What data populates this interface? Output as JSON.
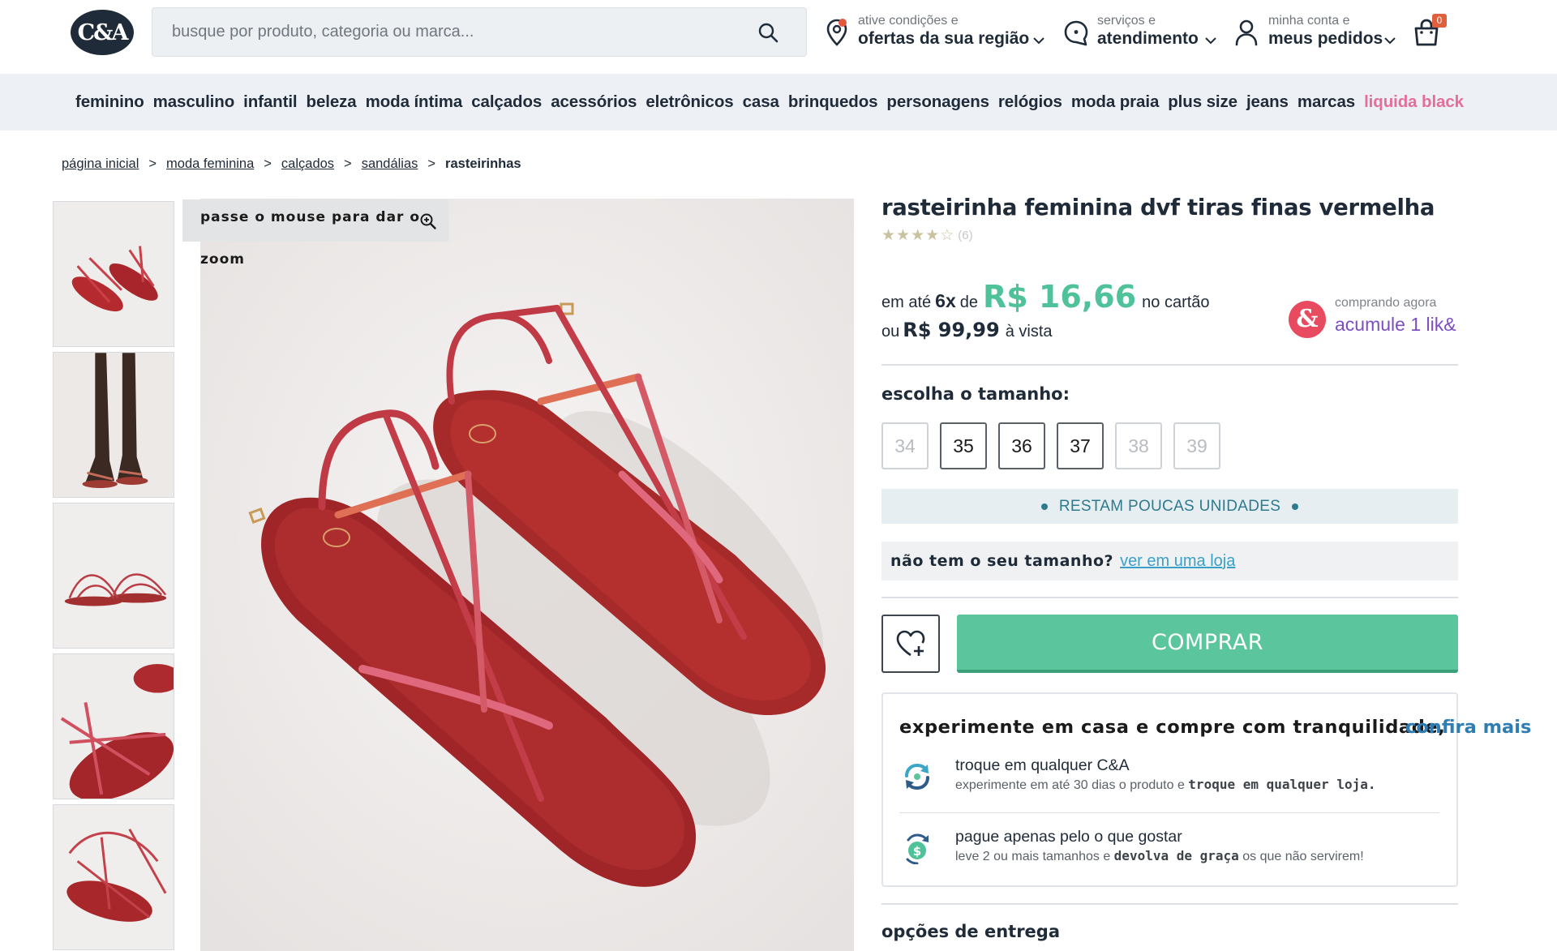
{
  "header": {
    "logo_text": "C&A",
    "search_placeholder": "busque por produto, categoria ou marca...",
    "location": {
      "small": "ative condições e",
      "big": "ofertas da sua região"
    },
    "service": {
      "small": "serviços e",
      "big": "atendimento"
    },
    "account": {
      "small": "minha conta e",
      "big": "meus pedidos"
    },
    "cart_count": "0"
  },
  "nav": {
    "items": [
      "feminino",
      "masculino",
      "infantil",
      "beleza",
      "moda íntima",
      "calçados",
      "acessórios",
      "eletrônicos",
      "casa",
      "brinquedos",
      "personagens",
      "relógios",
      "moda praia",
      "plus size",
      "jeans",
      "marcas"
    ],
    "promo": "liquida black"
  },
  "breadcrumb": {
    "items": [
      "página inicial",
      "moda feminina",
      "calçados",
      "sandálias"
    ],
    "separator": ">",
    "current": "rasteirinhas"
  },
  "gallery": {
    "zoom_hint_line1": "passe o mouse para dar o",
    "zoom_hint_line2": "zoom"
  },
  "product": {
    "title": "rasteirinha feminina dvf tiras finas vermelha",
    "rating": 4,
    "rating_max": 5,
    "review_count": "(6)",
    "installment_prefix": "em até",
    "installment_count": "6x",
    "installment_of": "de",
    "installment_value": "R$ 16,66",
    "installment_suffix": "no cartão",
    "cash_prefix": "ou",
    "cash_value": "R$ 99,99",
    "cash_suffix": "à vista"
  },
  "likand": {
    "icon": "&",
    "small": "comprando agora",
    "big": "acumule 1 lik&"
  },
  "sizes": {
    "title": "escolha o tamanho:",
    "options": [
      {
        "label": "34",
        "available": false
      },
      {
        "label": "35",
        "available": true
      },
      {
        "label": "36",
        "available": true
      },
      {
        "label": "37",
        "available": true
      },
      {
        "label": "38",
        "available": false
      },
      {
        "label": "39",
        "available": false
      }
    ]
  },
  "stock": {
    "text": "RESTAM POUCAS UNIDADES"
  },
  "no_size": {
    "label": "não tem o seu tamanho?",
    "link": "ver em uma loja"
  },
  "actions": {
    "buy_label": "COMPRAR"
  },
  "trial": {
    "title": "experimente em casa e compre com tranquilidade,",
    "link": "confira mais",
    "item1": {
      "title": "troque em qualquer C&A",
      "desc_pre": "experimente em até 30 dias o produto e",
      "desc_bold": "troque em qualquer loja."
    },
    "item2": {
      "title": "pague apenas pelo o que gostar",
      "desc_pre": "leve 2 ou mais tamanhos e",
      "desc_bold": "devolva de graça",
      "desc_post": "os que não servirem!"
    }
  },
  "delivery": {
    "title": "opções de entrega"
  },
  "colors": {
    "brand_dark": "#1f2b38",
    "promo_pink": "#e36e9c",
    "price_green": "#4fc29a",
    "buy_green": "#5bc59d",
    "likand_purple": "#7c4ec0",
    "stock_teal": "#2f7a8c",
    "link_blue": "#2e7db5"
  }
}
